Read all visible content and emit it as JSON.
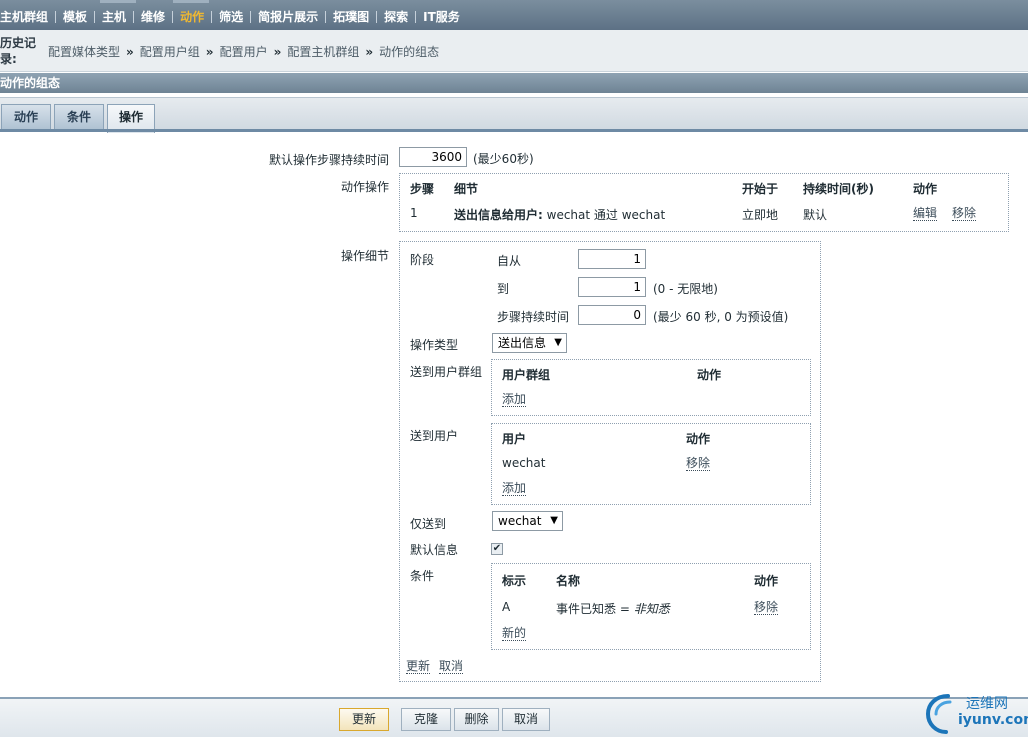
{
  "nav": {
    "items": [
      {
        "label": "主机群组",
        "active": false
      },
      {
        "label": "模板",
        "active": false
      },
      {
        "label": "主机",
        "active": false
      },
      {
        "label": "维修",
        "active": false
      },
      {
        "label": "动作",
        "active": true
      },
      {
        "label": "筛选",
        "active": false
      },
      {
        "label": "简报片展示",
        "active": false
      },
      {
        "label": "拓璞图",
        "active": false
      },
      {
        "label": "探索",
        "active": false
      },
      {
        "label": "IT服务",
        "active": false
      }
    ],
    "accent_color": "#f0b830"
  },
  "history": {
    "label_line1": "历史记",
    "label_line2": "录:",
    "crumbs": [
      "配置媒体类型",
      "配置用户组",
      "配置用户",
      "配置主机群组",
      "动作的组态"
    ],
    "separator": "»"
  },
  "section_title": "动作的组态",
  "tabs": [
    {
      "label": "动作",
      "active": false
    },
    {
      "label": "条件",
      "active": false
    },
    {
      "label": "操作",
      "active": true
    }
  ],
  "form": {
    "default_step_duration_label": "默认操作步骤持续时间",
    "default_step_duration_value": "3600",
    "default_step_duration_hint": "(最少60秒)",
    "operations_label": "动作操作",
    "operations_table": {
      "headers": [
        "步骤",
        "细节",
        "开始于",
        "持续时间(秒)",
        "动作"
      ],
      "rows": [
        {
          "step": "1",
          "detail_bold": "送出信息给用户:",
          "detail_rest": "wechat 通过 wechat",
          "start": "立即地",
          "duration": "默认",
          "edit": "编辑",
          "remove": "移除"
        }
      ]
    },
    "details_label": "操作细节",
    "details": {
      "stage_label": "阶段",
      "from_label": "自从",
      "from_value": "1",
      "to_label": "到",
      "to_value": "1",
      "to_hint": "(0 - 无限地)",
      "step_duration_label": "步骤持续时间",
      "step_duration_value": "0",
      "step_duration_hint": "(最少 60 秒, 0 为预设值)",
      "op_type_label": "操作类型",
      "op_type_value": "送出信息",
      "send_groups_label": "送到用户群组",
      "groups_headers": [
        "用户群组",
        "动作"
      ],
      "groups_add": "添加",
      "send_users_label": "送到用户",
      "users_headers": [
        "用户",
        "动作"
      ],
      "users_rows": [
        {
          "name": "wechat",
          "remove": "移除"
        }
      ],
      "users_add": "添加",
      "only_to_label": "仅送到",
      "only_to_value": "wechat",
      "default_msg_label": "默认信息",
      "default_msg_checked": true,
      "conditions_label": "条件",
      "cond_headers": [
        "标示",
        "名称",
        "动作"
      ],
      "cond_rows": [
        {
          "id": "A",
          "name": "事件已知悉 = ",
          "value": "非知悉",
          "remove": "移除"
        }
      ],
      "cond_new": "新的",
      "update_link": "更新",
      "cancel_link": "取消"
    }
  },
  "footer": {
    "buttons": [
      "更新",
      "克隆",
      "删除",
      "取消"
    ]
  },
  "watermark": {
    "line1": "运维网",
    "line2": "iyunv.com"
  }
}
